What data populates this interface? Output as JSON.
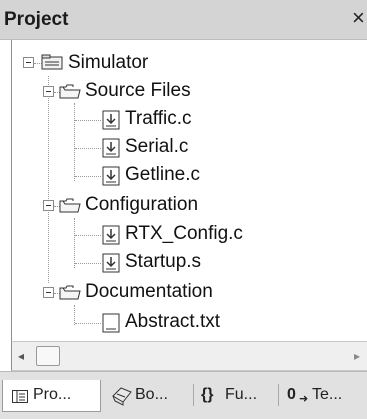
{
  "window": {
    "title": "Project",
    "close_glyph": "×"
  },
  "tree": {
    "root": {
      "label": "Simulator",
      "icon": "project-root-icon"
    },
    "groups": [
      {
        "label": "Source Files",
        "icon": "folder-icon",
        "files": [
          "Traffic.c",
          "Serial.c",
          "Getline.c"
        ]
      },
      {
        "label": "Configuration",
        "icon": "folder-icon",
        "files": [
          "RTX_Config.c",
          "Startup.s"
        ]
      },
      {
        "label": "Documentation",
        "icon": "folder-icon",
        "files": [
          "Abstract.txt"
        ]
      }
    ]
  },
  "scrollbar": {
    "left_arrow": "◂",
    "right_arrow": "▸"
  },
  "tabs": [
    {
      "label": "Pro...",
      "icon": "project-tab-icon",
      "active": true
    },
    {
      "label": "Bo...",
      "icon": "books-tab-icon",
      "active": false
    },
    {
      "label": "Fu...",
      "icon": "functions-tab-icon",
      "glyph": "{}",
      "active": false
    },
    {
      "label": "Te...",
      "icon": "templates-tab-icon",
      "glyph": "0",
      "active": false
    }
  ]
}
